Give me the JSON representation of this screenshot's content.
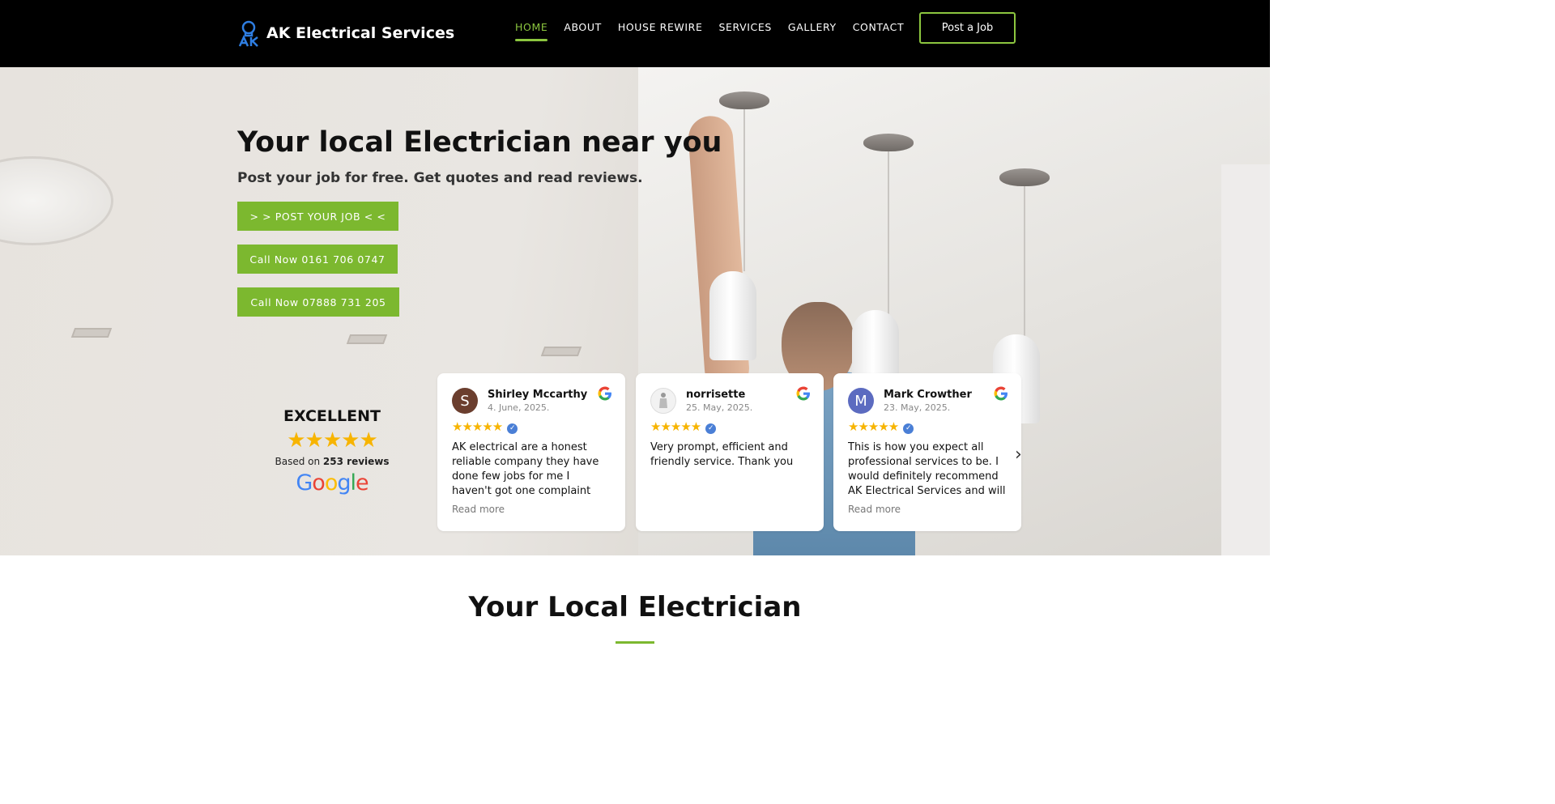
{
  "header": {
    "brand": "AK Electrical Services",
    "nav": [
      {
        "label": "HOME",
        "active": true
      },
      {
        "label": "ABOUT",
        "active": false
      },
      {
        "label": "HOUSE REWIRE",
        "active": false
      },
      {
        "label": "SERVICES",
        "active": false
      },
      {
        "label": "GALLERY",
        "active": false
      },
      {
        "label": "CONTACT",
        "active": false
      }
    ],
    "post_job_label": "Post a Job"
  },
  "hero": {
    "title": "Your local Electrician near you",
    "subtitle": "Post your job for free. Get quotes and read reviews.",
    "buttons": [
      "> > POST YOUR JOB < <",
      "Call Now 0161 706 0747",
      "Call Now 07888 731 205"
    ]
  },
  "rating": {
    "label": "EXCELLENT",
    "stars": 5,
    "based_on_prefix": "Based on",
    "reviews_count": "253 reviews",
    "google_word": "Google"
  },
  "reviews": [
    {
      "initial": "S",
      "name": "Shirley Mccarthy",
      "date": "4. June, 2025.",
      "stars": 5,
      "text": "AK electrical are a honest reliable company they have done few jobs for me I haven't got one complaint about the...",
      "read_more": "Read more",
      "avatar_color": "#6b3e2e"
    },
    {
      "initial": "",
      "name": "norrisette",
      "date": "25. May, 2025.",
      "stars": 5,
      "text": "Very prompt, efficient and friendly service. Thank you",
      "read_more": "",
      "avatar_color": "#f2f2f2"
    },
    {
      "initial": "M",
      "name": "Mark Crowther",
      "date": "23. May, 2025.",
      "stars": 5,
      "text": "This is how you expect all professional services to be. I would definitely recommend AK Electrical Services and will be...",
      "read_more": "Read more",
      "avatar_color": "#5c6bc0"
    }
  ],
  "section": {
    "title": "Your Local Electrician"
  },
  "colors": {
    "accent": "#7cb82f",
    "header_bg": "#000000",
    "star": "#f7b400"
  },
  "icons": {
    "logo": "lightbulb-logo-icon",
    "google": "google-g-icon",
    "verified": "verified-badge-icon",
    "next": "chevron-right-icon"
  }
}
